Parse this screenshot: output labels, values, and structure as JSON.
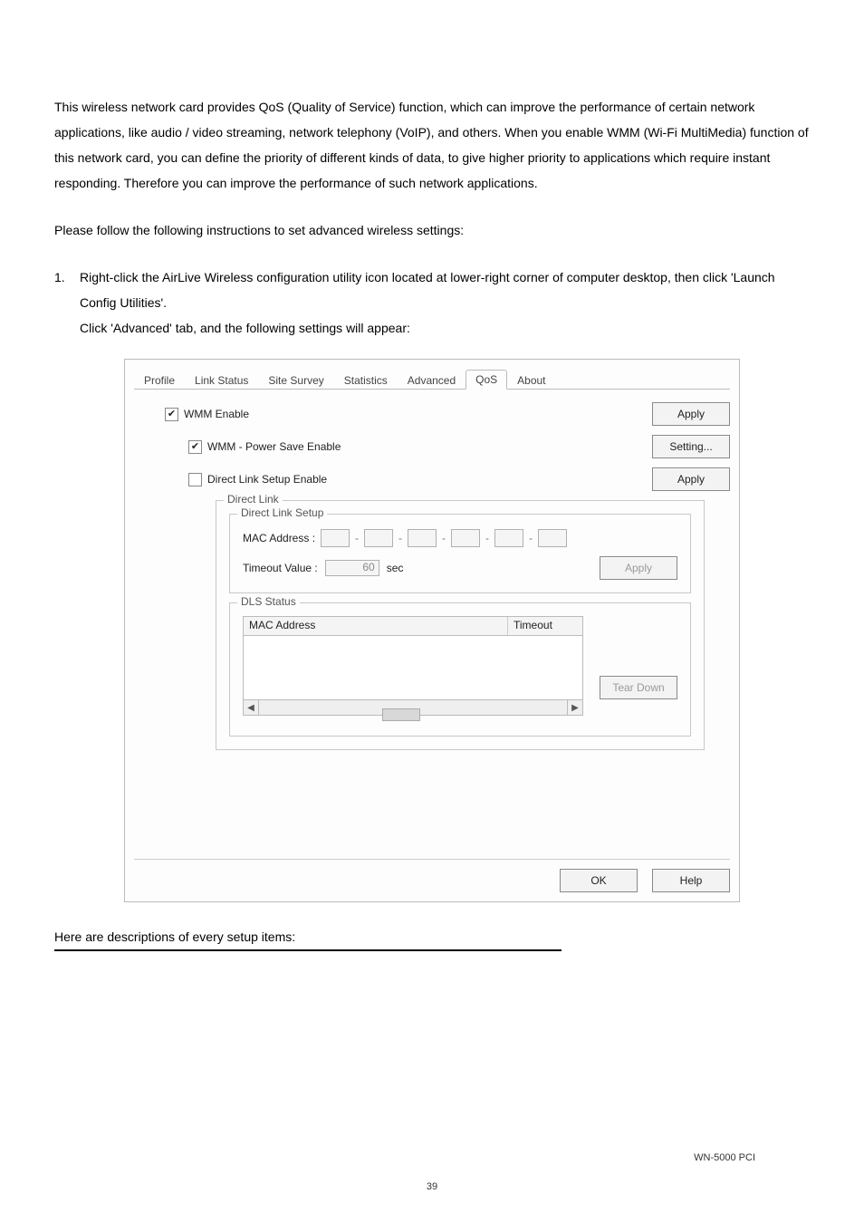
{
  "body": {
    "p1": "This wireless network card provides QoS (Quality of Service) function, which can improve the performance of certain network applications, like audio / video streaming, network telephony (VoIP), and others. When you enable WMM (Wi-Fi MultiMedia) function of this network card, you can define the priority of different kinds of data, to give higher priority to applications which require instant responding. Therefore you can improve the performance of such network applications.",
    "p2": "Please follow the following instructions to set advanced wireless settings:",
    "list1_num": "1.",
    "list1_a": "Right-click the AirLive Wireless configuration utility icon located at lower-right corner of computer desktop, then click 'Launch Config Utilities'.",
    "list1_b": "Click 'Advanced' tab, and the following settings will appear:",
    "desc_head": "Here are descriptions of every setup items:"
  },
  "dialog": {
    "tabs": {
      "profile": "Profile",
      "link_status": "Link Status",
      "site_survey": "Site Survey",
      "statistics": "Statistics",
      "advanced": "Advanced",
      "qos": "QoS",
      "about": "About"
    },
    "wmm_enable": "WMM Enable",
    "wmm_ps": "WMM - Power Save Enable",
    "dls_enable": "Direct Link Setup Enable",
    "apply": "Apply",
    "setting": "Setting...",
    "direct_link_legend": "Direct Link",
    "dls_setup_legend": "Direct Link Setup",
    "mac_label": "MAC Address :",
    "timeout_label": "Timeout Value :",
    "timeout_value": "60",
    "sec": "sec",
    "dls_status_legend": "DLS Status",
    "th_mac": "MAC Address",
    "th_timeout": "Timeout",
    "teardown": "Tear Down",
    "ok": "OK",
    "help": "Help",
    "check_mark": "✔",
    "dash": "-",
    "arr_l": "◀",
    "arr_r": "▶"
  },
  "footer": {
    "model": "WN-5000 PCI",
    "page": "39"
  }
}
